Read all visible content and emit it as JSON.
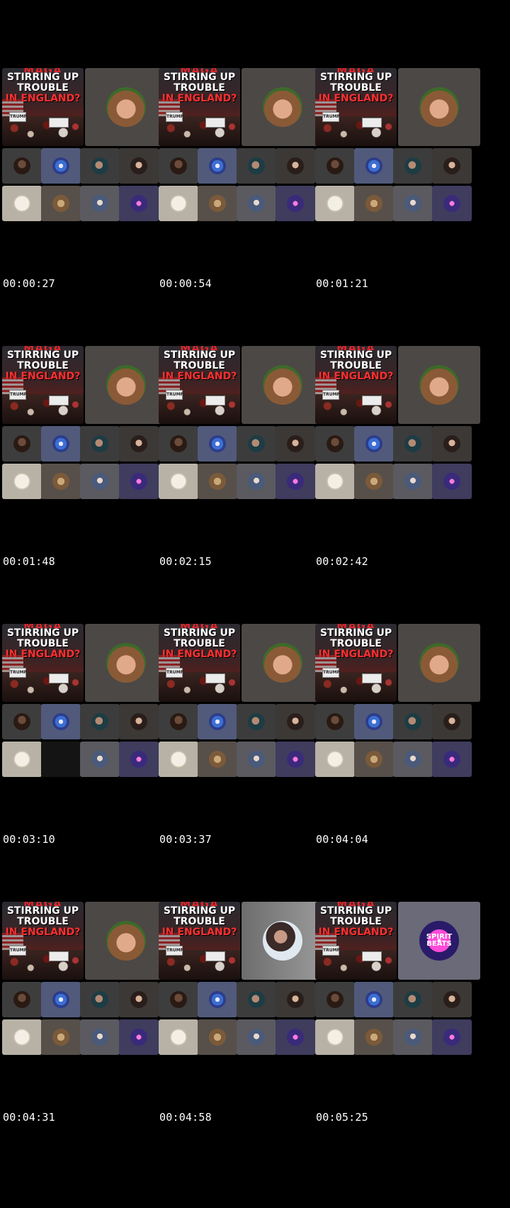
{
  "poster": {
    "line1": "MAGA",
    "line2": "STIRRING UP",
    "line3": "TROUBLE",
    "line4": "IN ENGLAND?",
    "subtext": "TRUMP"
  },
  "frames": [
    {
      "timestamp": "00:00:27",
      "big": "bear",
      "empty_slot": false
    },
    {
      "timestamp": "00:00:54",
      "big": "bear",
      "empty_slot": false
    },
    {
      "timestamp": "00:01:21",
      "big": "bear",
      "empty_slot": false
    },
    {
      "timestamp": "00:01:48",
      "big": "bear",
      "empty_slot": false
    },
    {
      "timestamp": "00:02:15",
      "big": "bear",
      "empty_slot": false
    },
    {
      "timestamp": "00:02:42",
      "big": "bear",
      "empty_slot": false
    },
    {
      "timestamp": "00:03:10",
      "big": "bear",
      "empty_slot": true
    },
    {
      "timestamp": "00:03:37",
      "big": "bear",
      "empty_slot": false
    },
    {
      "timestamp": "00:04:04",
      "big": "bear",
      "empty_slot": false
    },
    {
      "timestamp": "00:04:31",
      "big": "bear",
      "empty_slot": false
    },
    {
      "timestamp": "00:04:58",
      "big": "portrait",
      "empty_slot": false
    },
    {
      "timestamp": "00:05:25",
      "big": "spirit-beats",
      "empty_slot": false
    }
  ],
  "spirit_logo": {
    "line1": "SPIRIT",
    "line2": "BEATS"
  },
  "colors": {
    "background": "#000000",
    "tile": "#3a3a3a",
    "tile_light": "#5a5a5a",
    "tile_purple": "#4a4e6a",
    "poster_red": "#e0262b"
  }
}
